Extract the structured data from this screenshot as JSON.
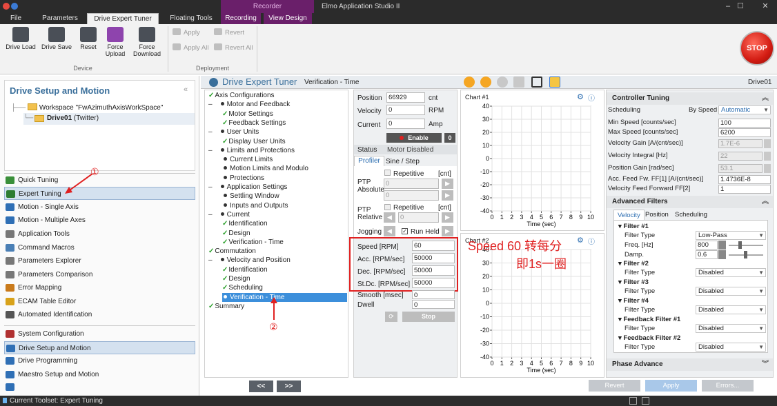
{
  "window": {
    "title": "Elmo Application Studio II",
    "recorder_label": "Recorder",
    "controls": [
      "–",
      "☐",
      "✕"
    ]
  },
  "ribbon_tabs": [
    {
      "label": "File"
    },
    {
      "label": "Parameters"
    },
    {
      "label": "Drive Expert Tuner"
    },
    {
      "label": "Floating Tools"
    },
    {
      "label": "Recording"
    },
    {
      "label": "View Design"
    }
  ],
  "ribbon": {
    "device": {
      "label": "Device",
      "buttons": [
        {
          "label": "Drive Load",
          "icon": "drive-load-icon"
        },
        {
          "label": "Drive Save",
          "icon": "drive-save-icon"
        },
        {
          "label": "Reset",
          "icon": "reset-icon"
        },
        {
          "label": "Force Upload",
          "icon": "force-upload-icon"
        },
        {
          "label": "Force Download",
          "icon": "force-download-icon"
        }
      ]
    },
    "deployment": {
      "label": "Deployment",
      "apply": "Apply",
      "revert": "Revert",
      "apply_all": "Apply All",
      "revert_all": "Revert All"
    },
    "stop": "STOP"
  },
  "left": {
    "title": "Drive Setup and Motion",
    "workspace": "Workspace \"FwAzimuthAxisWorkSpace\"",
    "drive_name": "Drive01",
    "drive_sub": " (Twitter)",
    "tools": [
      {
        "label": "Quick Tuning",
        "color": "#3a8f3a"
      },
      {
        "label": "Expert Tuning",
        "color": "#2e7d32"
      },
      {
        "label": "Motion - Single Axis",
        "color": "#2f6fb5"
      },
      {
        "label": "Motion - Multiple Axes",
        "color": "#2f6fb5"
      },
      {
        "label": "Application Tools",
        "color": "#777777"
      },
      {
        "label": "Command Macros",
        "color": "#4a7fb5"
      },
      {
        "label": "Parameters Explorer",
        "color": "#777777"
      },
      {
        "label": "Parameters Comparison",
        "color": "#777777"
      },
      {
        "label": "Error Mapping",
        "color": "#c97a1b"
      },
      {
        "label": "ECAM Table Editor",
        "color": "#d8a21a"
      },
      {
        "label": "Automated Identification",
        "color": "#555555"
      }
    ],
    "groups": [
      {
        "label": "System Configuration",
        "color": "#b03030"
      },
      {
        "label": "Drive Setup and Motion",
        "color": "#2f6fb5"
      },
      {
        "label": "Drive Programming",
        "color": "#2f6fb5"
      },
      {
        "label": "Maestro Setup and Motion",
        "color": "#2f6fb5"
      }
    ],
    "annotation_1": "①"
  },
  "header": {
    "title": "Drive Expert Tuner",
    "subtitle": "Verification - Time",
    "drive": "Drive01"
  },
  "tree": [
    {
      "label": "Axis Configurations",
      "level": 0,
      "mark": "check"
    },
    {
      "label": "Motor and Feedback",
      "level": 0,
      "mark": "minus-dot"
    },
    {
      "label": "Motor Settings",
      "level": 1,
      "mark": "check"
    },
    {
      "label": "Feedback Settings",
      "level": 1,
      "mark": "check"
    },
    {
      "label": "User Units",
      "level": 0,
      "mark": "minus-dot"
    },
    {
      "label": "Display User Units",
      "level": 1,
      "mark": "check"
    },
    {
      "label": "Limits and Protections",
      "level": 0,
      "mark": "minus-dot"
    },
    {
      "label": "Current Limits",
      "level": 1,
      "mark": "dot"
    },
    {
      "label": "Motion Limits and Modulo",
      "level": 1,
      "mark": "dot"
    },
    {
      "label": "Protections",
      "level": 1,
      "mark": "dot"
    },
    {
      "label": "Application Settings",
      "level": 0,
      "mark": "minus-dot"
    },
    {
      "label": "Settling Window",
      "level": 1,
      "mark": "dot"
    },
    {
      "label": "Inputs and Outputs",
      "level": 1,
      "mark": "dot"
    },
    {
      "label": "Current",
      "level": 0,
      "mark": "minus-dot"
    },
    {
      "label": "Identification",
      "level": 1,
      "mark": "check"
    },
    {
      "label": "Design",
      "level": 1,
      "mark": "check"
    },
    {
      "label": "Verification - Time",
      "level": 1,
      "mark": "check"
    },
    {
      "label": "Commutation",
      "level": 0,
      "mark": "check"
    },
    {
      "label": "Velocity and Position",
      "level": 0,
      "mark": "minus-dot"
    },
    {
      "label": "Identification",
      "level": 1,
      "mark": "check"
    },
    {
      "label": "Design",
      "level": 1,
      "mark": "check"
    },
    {
      "label": "Scheduling",
      "level": 1,
      "mark": "check"
    },
    {
      "label": "Verification - Time",
      "level": 1,
      "mark": "dot",
      "selected": true
    },
    {
      "label": "Summary",
      "level": 0,
      "mark": "check"
    }
  ],
  "annotation_2": "②",
  "form": {
    "position_label": "Position",
    "position": "66929",
    "position_unit": "cnt",
    "velocity_label": "Velocity",
    "velocity": "0",
    "velocity_unit": "RPM",
    "current_label": "Current",
    "current": "0",
    "current_unit": "Amp",
    "enable": "Enable",
    "enable_count": "0",
    "status_label": "Status",
    "status": "Motor Disabled",
    "tab_profiler": "Profiler",
    "tab_sine": "Sine / Step",
    "repetitive": "Repetitive",
    "cnt": "[cnt]",
    "ptp_abs": "PTP\nAbsolute",
    "ptp_abs_1": "0",
    "ptp_abs_2": "0",
    "ptp_rel": "PTP\nRelative",
    "ptp_rel_1": "0",
    "jogging": "Jogging",
    "run_held": "Run Held",
    "speed_label": "Speed [RPM]",
    "speed": "60",
    "acc_label": "Acc. [RPM/sec]",
    "acc": "50000",
    "dec_label": "Dec. [RPM/sec]",
    "dec": "50000",
    "stdc_label": "St.Dc. [RPM/sec]",
    "stdc": "50000",
    "smooth_label": "Smooth [msec]",
    "smooth": "0",
    "dwell_label": "Dwell",
    "dwell": "0",
    "stop": "Stop"
  },
  "annotation_text": {
    "line1": "Speed 60 转每分",
    "line2": "即1s一圈"
  },
  "chart_data": [
    {
      "type": "line",
      "title": "Chart #1",
      "xlabel": "Time (sec)",
      "ylabel": "",
      "xlim": [
        0,
        10
      ],
      "ylim": [
        -40,
        40
      ],
      "xticks": [
        0,
        1,
        2,
        3,
        4,
        5,
        6,
        7,
        8,
        9,
        10
      ],
      "yticks": [
        40,
        30,
        20,
        10,
        0,
        -10,
        -20,
        -30,
        -40
      ],
      "grid": true,
      "series": []
    },
    {
      "type": "line",
      "title": "Chart #2",
      "xlabel": "Time (sec)",
      "ylabel": "",
      "xlim": [
        0,
        10
      ],
      "ylim": [
        -40,
        40
      ],
      "xticks": [
        0,
        1,
        2,
        3,
        4,
        5,
        6,
        7,
        8,
        9,
        10
      ],
      "yticks": [
        40,
        30,
        20,
        10,
        0,
        -10,
        -20,
        -30,
        -40
      ],
      "grid": true,
      "series": []
    }
  ],
  "controller": {
    "title": "Controller Tuning",
    "scheduling_label": "Scheduling",
    "scheduling_by": "By Speed",
    "scheduling_value": "Automatic",
    "rows": [
      {
        "label": "Min Speed [counts/sec]",
        "value": "100",
        "disabled": false
      },
      {
        "label": "Max Speed [counts/sec]",
        "value": "6200",
        "disabled": false
      },
      {
        "label": "Velocity Gain [A/(cnt/sec)]",
        "value": "1.7E-6",
        "disabled": true
      },
      {
        "label": "Velocity Integral [Hz]",
        "value": "22",
        "disabled": true
      },
      {
        "label": "Position Gain [rad/sec]",
        "value": "53.1",
        "disabled": true
      },
      {
        "label": "Acc. Feed Fw. FF[1] [A/(cnt/sec)]",
        "value": "1.4736E-8",
        "disabled": false
      },
      {
        "label": "Velocity Feed Forward FF[2]",
        "value": "1",
        "disabled": false
      }
    ]
  },
  "filters": {
    "title": "Advanced Filters",
    "tabs": [
      "Velocity",
      "Position",
      "Scheduling"
    ],
    "filter1": {
      "name": "Filter #1",
      "type_label": "Filter Type",
      "type": "Low-Pass",
      "freq_label": "Freq. [Hz]",
      "freq": "800",
      "damp_label": "Damp.",
      "damp": "0.6"
    },
    "others": [
      {
        "name": "Filter #2",
        "type_label": "Filter Type",
        "type": "Disabled"
      },
      {
        "name": "Filter #3",
        "type_label": "Filter Type",
        "type": "Disabled"
      },
      {
        "name": "Filter #4",
        "type_label": "Filter Type",
        "type": "Disabled"
      },
      {
        "name": "Feedback Filter #1",
        "type_label": "Filter Type",
        "type": "Disabled"
      },
      {
        "name": "Feedback Filter #2",
        "type_label": "Filter Type",
        "type": "Disabled"
      }
    ],
    "phase_advance": "Phase Advance"
  },
  "bottom": {
    "prev": "<<",
    "next": ">>",
    "revert": "Revert",
    "apply": "Apply",
    "errors": "Errors..."
  },
  "status": "Current Toolset: Expert Tuning",
  "colors": {
    "accent": "#3a6f9b",
    "selection": "#3c8fdb",
    "annotation": "#e02020",
    "check": "#2ca02c"
  }
}
